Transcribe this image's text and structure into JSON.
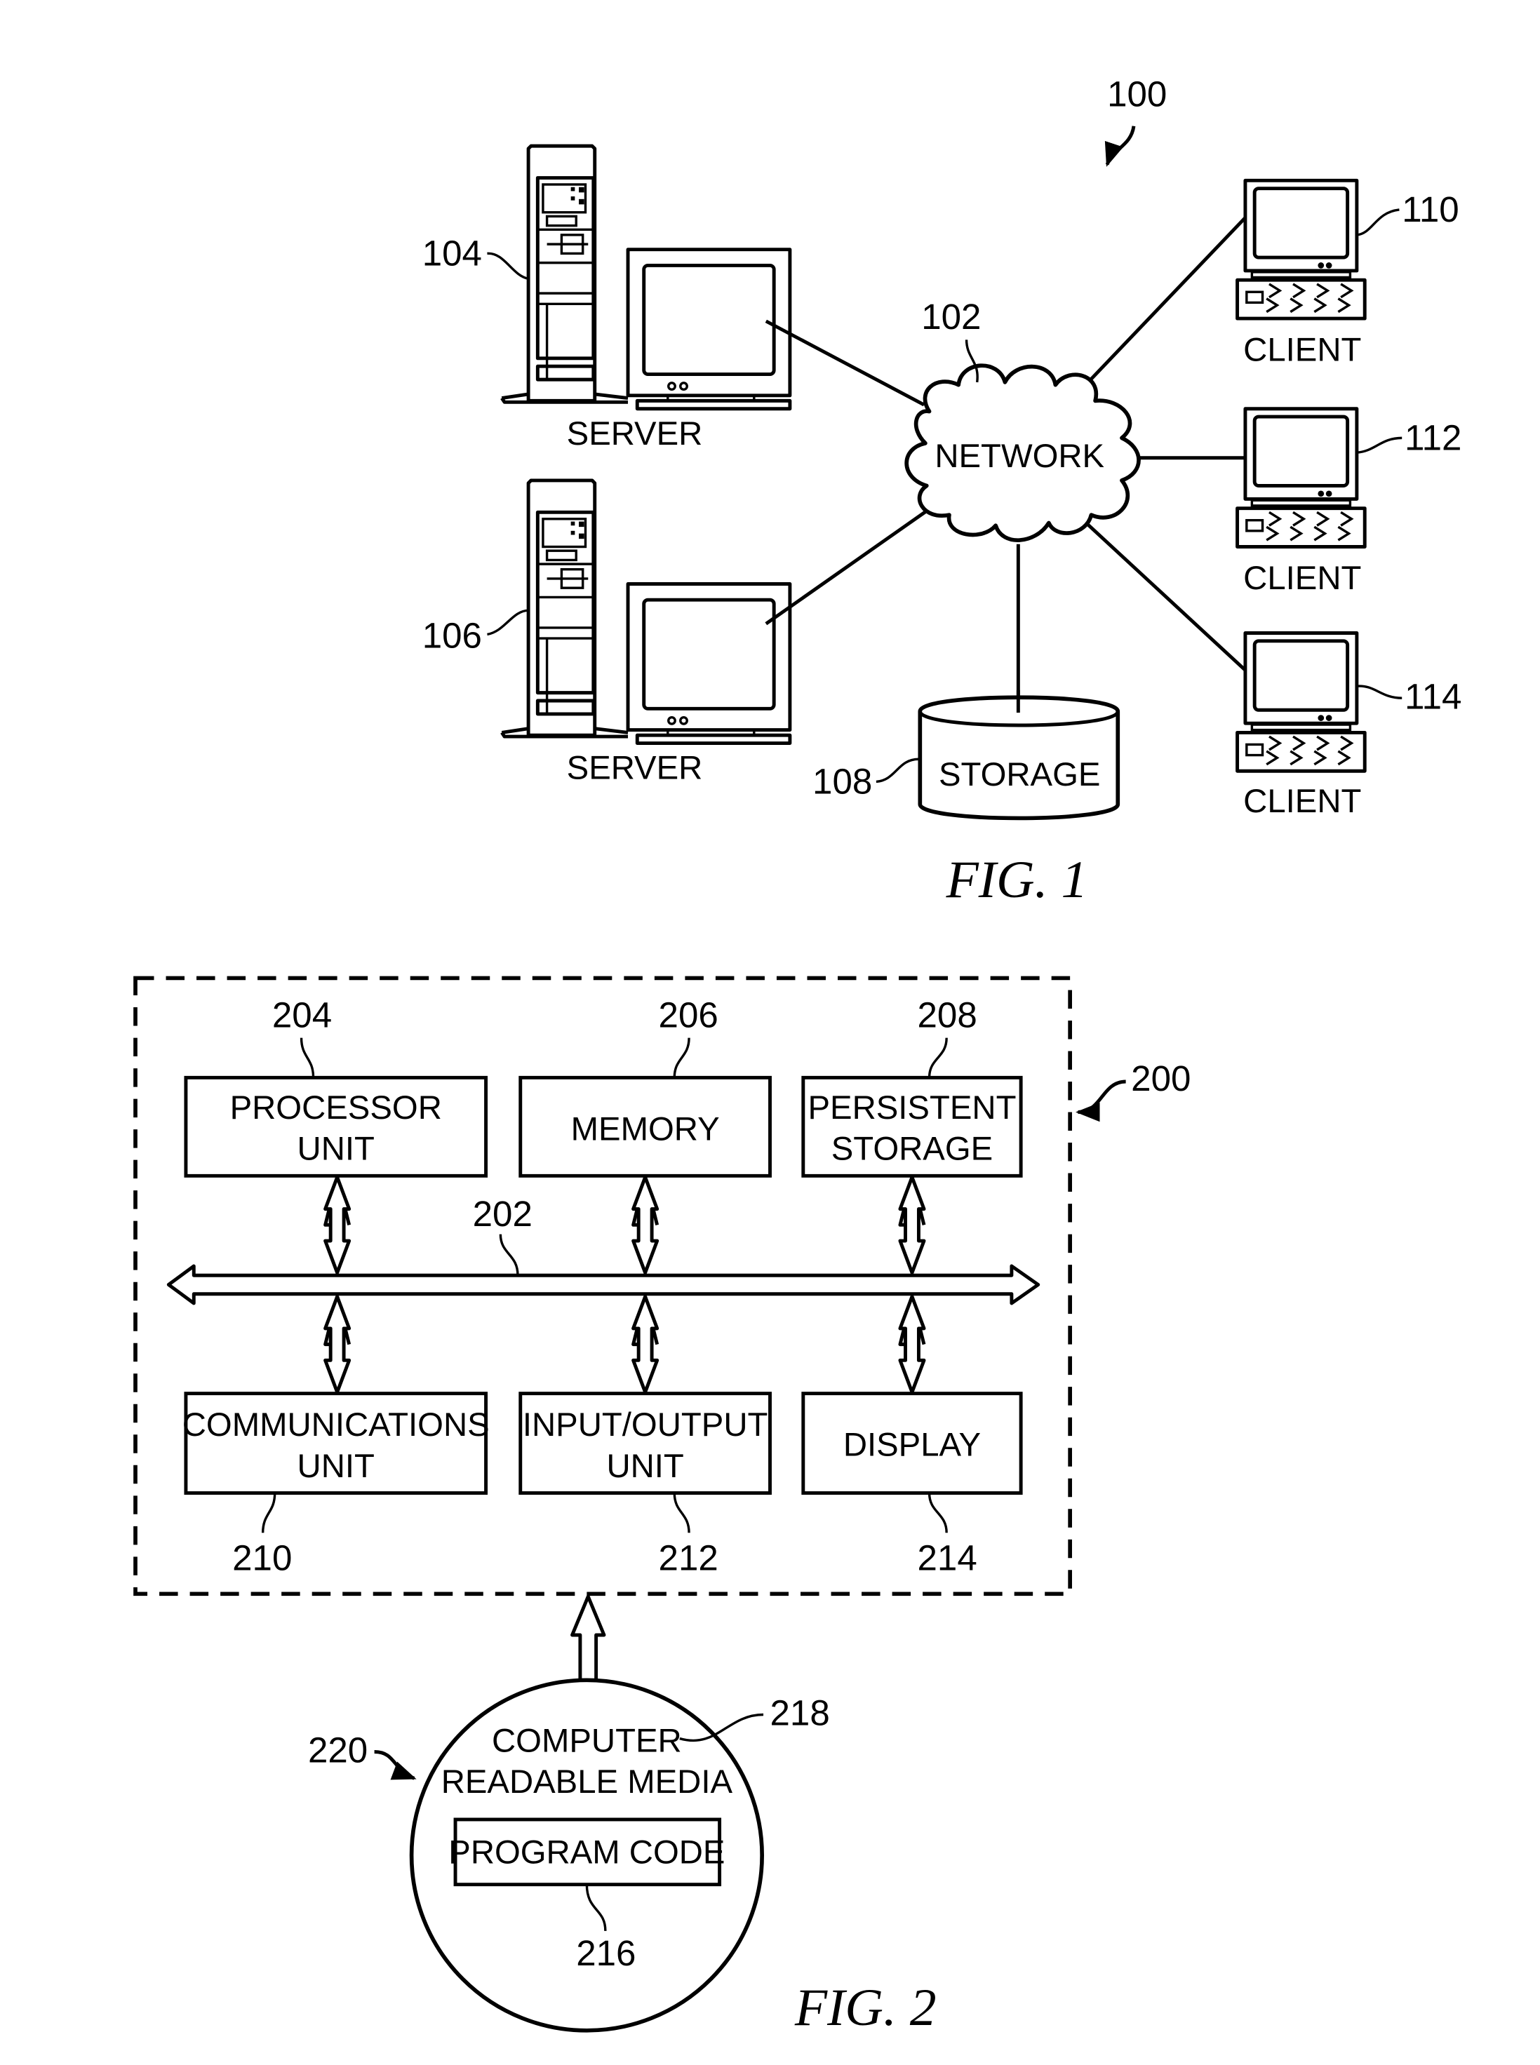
{
  "figure1": {
    "caption": "FIG. 1",
    "system_ref": "100",
    "network": {
      "label": "NETWORK",
      "ref": "102"
    },
    "servers": [
      {
        "label": "SERVER",
        "ref": "104"
      },
      {
        "label": "SERVER",
        "ref": "106"
      }
    ],
    "storage": {
      "label": "STORAGE",
      "ref": "108"
    },
    "clients": [
      {
        "label": "CLIENT",
        "ref": "110"
      },
      {
        "label": "CLIENT",
        "ref": "112"
      },
      {
        "label": "CLIENT",
        "ref": "114"
      }
    ]
  },
  "figure2": {
    "caption": "FIG. 2",
    "system_ref": "200",
    "bus_ref": "202",
    "components": [
      {
        "line1": "PROCESSOR",
        "line2": "UNIT",
        "ref": "204"
      },
      {
        "line1": "MEMORY",
        "line2": "",
        "ref": "206"
      },
      {
        "line1": "PERSISTENT",
        "line2": "STORAGE",
        "ref": "208"
      },
      {
        "line1": "COMMUNICATIONS",
        "line2": "UNIT",
        "ref": "210"
      },
      {
        "line1": "INPUT/OUTPUT",
        "line2": "UNIT",
        "ref": "212"
      },
      {
        "line1": "DISPLAY",
        "line2": "",
        "ref": "214"
      }
    ],
    "media": {
      "line1": "COMPUTER",
      "line2": "READABLE MEDIA",
      "ref": "218",
      "product_ref": "220",
      "program_code": {
        "label": "PROGRAM CODE",
        "ref": "216"
      }
    }
  }
}
